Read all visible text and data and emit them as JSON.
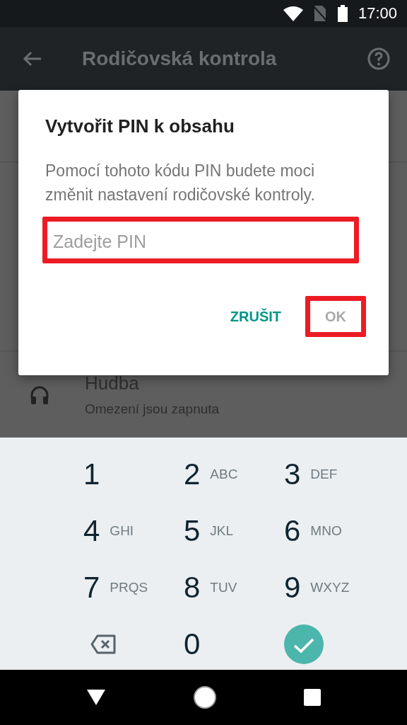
{
  "status_bar": {
    "time": "17:00"
  },
  "app_bar": {
    "title": "Rodičovská kontrola"
  },
  "list": [
    {
      "title": "Hudba",
      "subtitle": "Omezení jsou zapnuta"
    }
  ],
  "dialog": {
    "title": "Vytvořit PIN k obsahu",
    "message": "Pomocí tohoto kódu PIN budete moci změnit nastavení rodičovské kontroly.",
    "pin_field": {
      "placeholder": "Zadejte PIN",
      "highlighted": true
    },
    "buttons": [
      {
        "label": "ZRUŠIT",
        "disabled": false,
        "highlighted": false
      },
      {
        "label": "OK",
        "disabled": true,
        "highlighted": true
      }
    ]
  },
  "keypad": [
    {
      "kind": "digit",
      "digit": "1"
    },
    {
      "kind": "digit",
      "digit": "2",
      "letters": "ABC"
    },
    {
      "kind": "digit",
      "digit": "3",
      "letters": "DEF"
    },
    {
      "kind": "digit",
      "digit": "4",
      "letters": "GHI"
    },
    {
      "kind": "digit",
      "digit": "5",
      "letters": "JKL"
    },
    {
      "kind": "digit",
      "digit": "6",
      "letters": "MNO"
    },
    {
      "kind": "digit",
      "digit": "7",
      "letters": "PRQS"
    },
    {
      "kind": "digit",
      "digit": "8",
      "letters": "TUV"
    },
    {
      "kind": "digit",
      "digit": "9",
      "letters": "WXYZ"
    },
    {
      "kind": "backspace"
    },
    {
      "kind": "digit",
      "digit": "0"
    },
    {
      "kind": "done"
    }
  ]
}
